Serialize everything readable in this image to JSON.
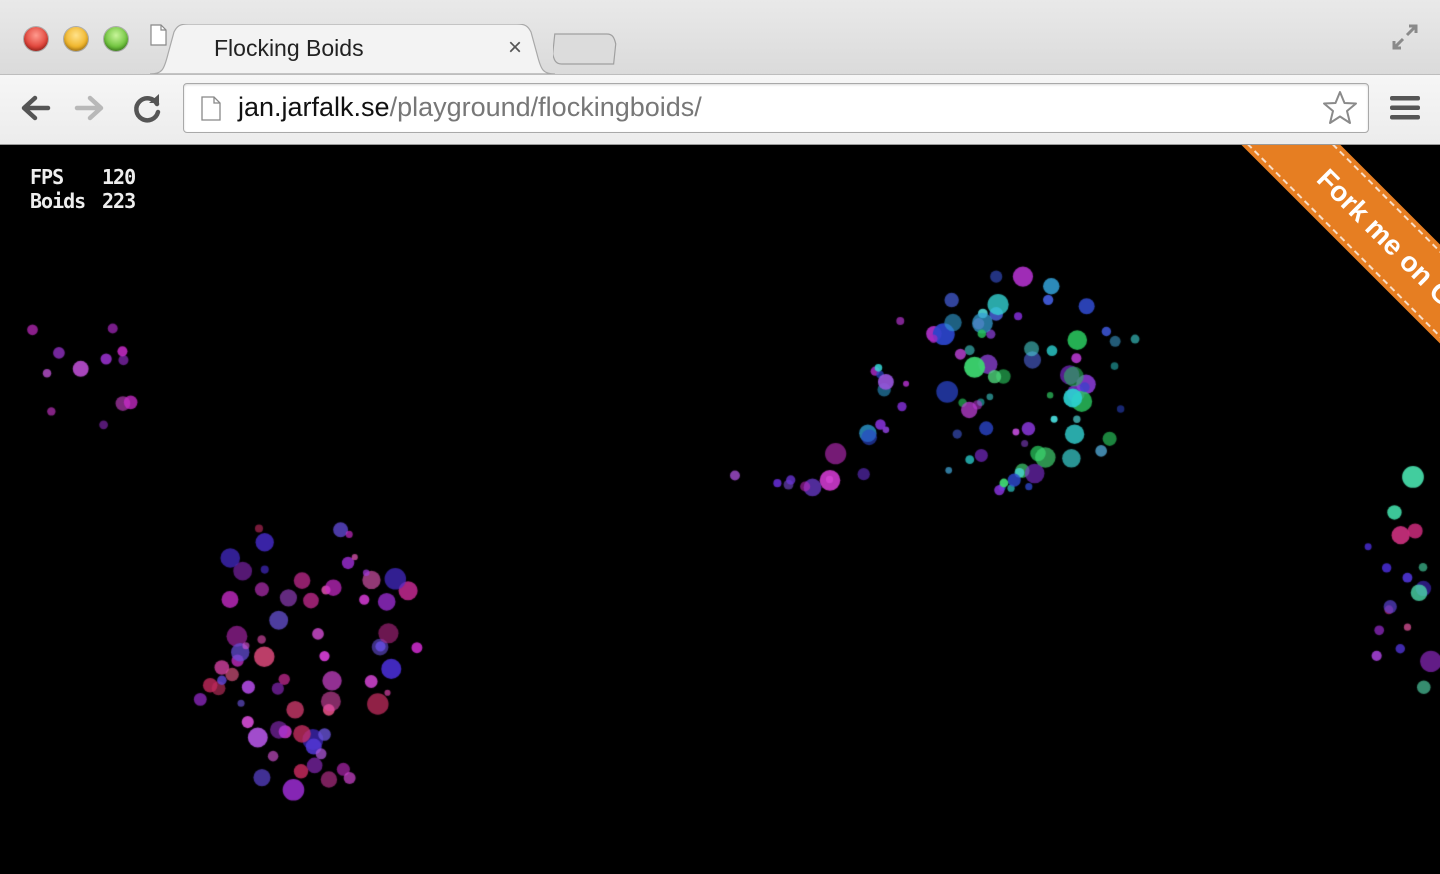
{
  "window": {
    "tab_title": "Flocking Boids",
    "tab_close": "×"
  },
  "toolbar": {
    "url_domain": "jan.jarfalk.se",
    "url_path": "/playground/flockingboids/"
  },
  "page": {
    "stats": {
      "fps_label": "FPS",
      "fps_value": "120",
      "boids_label": "Boids",
      "boids_value": "223"
    },
    "ribbon_text": "Fork me on GitHub",
    "ribbon_color": "#e67e22",
    "background": "#000000"
  },
  "icons": [
    "page-icon",
    "close-icon",
    "fullscreen-icon",
    "back-arrow-icon",
    "forward-arrow-icon",
    "reload-icon",
    "star-icon",
    "menu-icon"
  ]
}
